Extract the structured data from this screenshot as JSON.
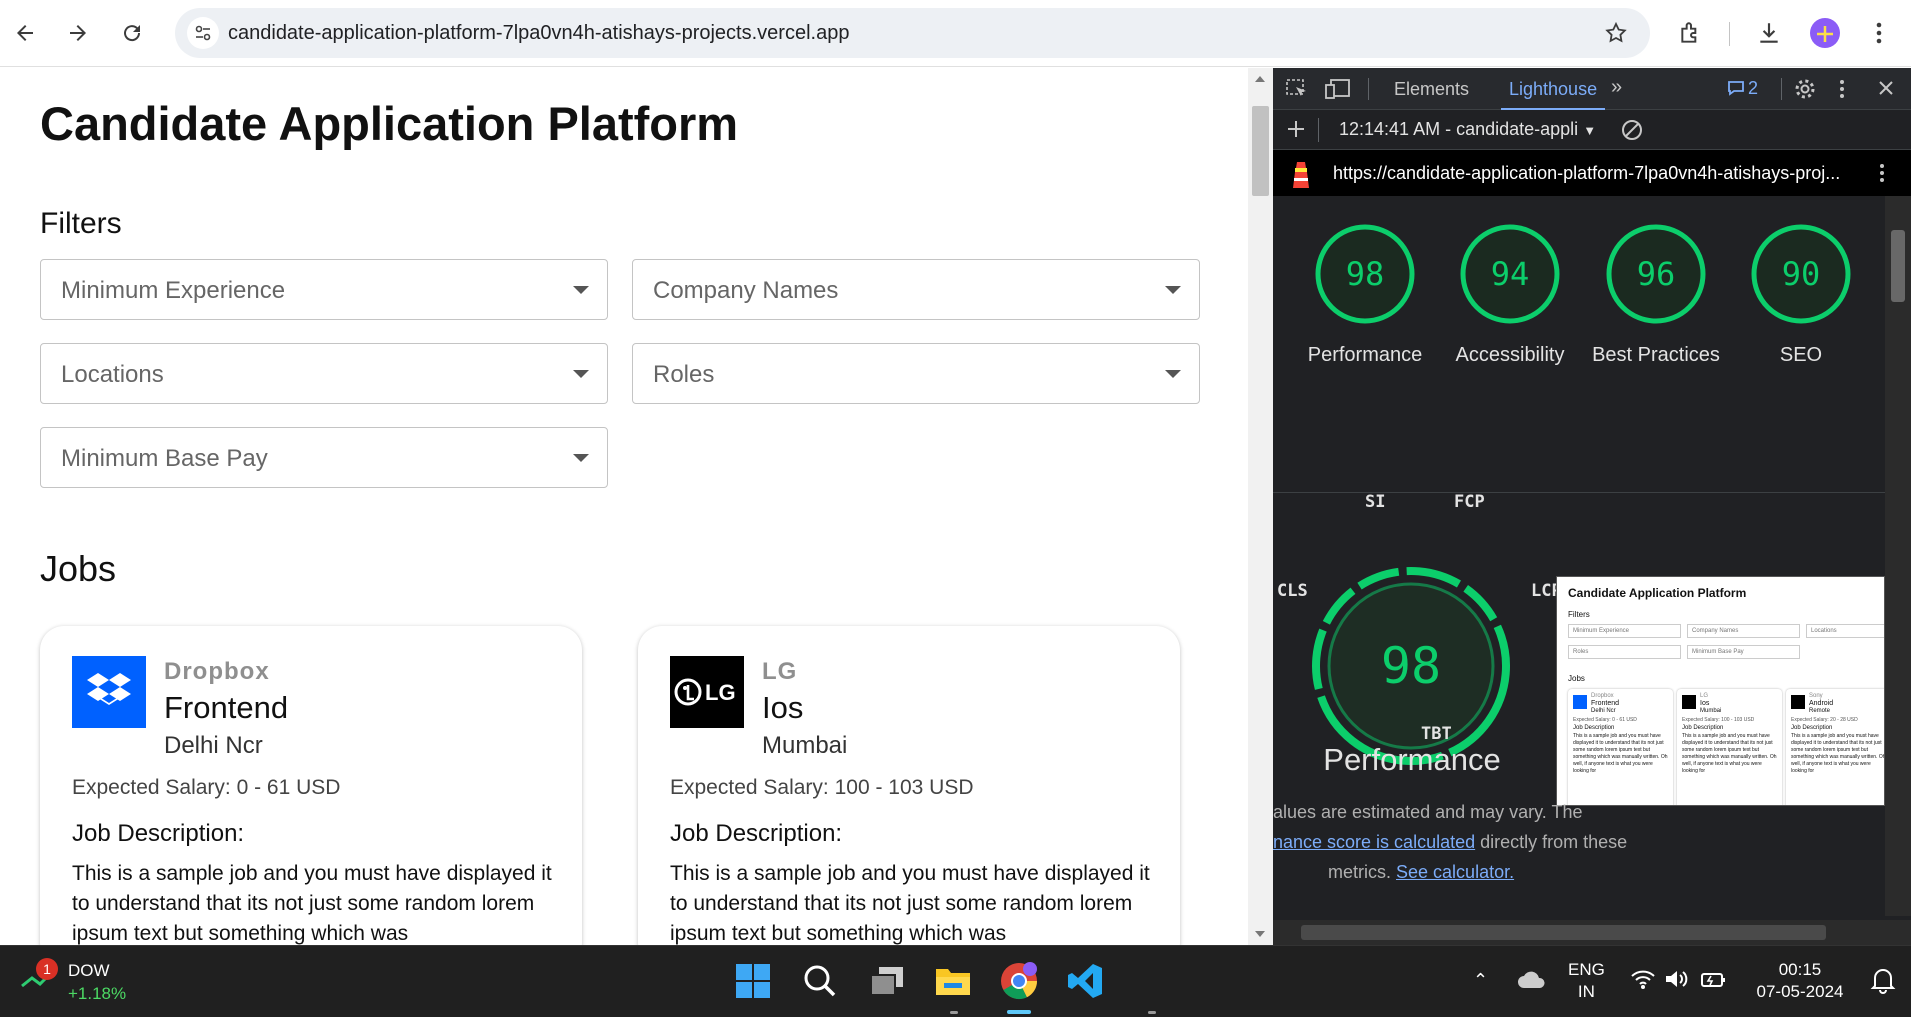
{
  "browser": {
    "url": "candidate-application-platform-7lpa0vn4h-atishays-projects.vercel.app"
  },
  "page": {
    "title": "Candidate Application Platform",
    "filters_heading": "Filters",
    "filters": [
      "Minimum Experience",
      "Company Names",
      "Locations",
      "Roles",
      "Minimum Base Pay"
    ],
    "jobs_heading": "Jobs",
    "jobs": [
      {
        "company": "Dropbox",
        "role": "Frontend",
        "location": "Delhi Ncr",
        "salary": "Expected Salary: 0 - 61 USD",
        "jd_title": "Job Description:",
        "jd": "This is a sample job and you must have displayed it to understand that its not just some random lorem ipsum text but something which was"
      },
      {
        "company": "LG",
        "role": "Ios",
        "location": "Mumbai",
        "salary": "Expected Salary: 100 - 103 USD",
        "jd_title": "Job Description:",
        "jd": "This is a sample job and you must have displayed it to understand that its not just some random lorem ipsum text but something which was"
      }
    ]
  },
  "devtools": {
    "tabs": [
      "Elements",
      "Lighthouse"
    ],
    "issues_count": "2",
    "report_select": "12:14:41 AM - candidate-appli",
    "report_url": "https://candidate-application-platform-7lpa0vn4h-atishays-proj...",
    "scores": [
      {
        "label": "Performance",
        "value": 98
      },
      {
        "label": "Accessibility",
        "value": 94
      },
      {
        "label": "Best Practices",
        "value": 96
      },
      {
        "label": "SEO",
        "value": 90
      }
    ],
    "perf_score": "98",
    "perf_title": "Performance",
    "metrics": [
      "SI",
      "FCP",
      "CLS",
      "LCP",
      "TBT"
    ],
    "note_line1": "alues are estimated and may vary. The",
    "note_link1": "nance score is calculated",
    "note_line2": " directly from these",
    "note_line3": "metrics.",
    "note_link2": "See calculator.",
    "thumb": {
      "title": "Candidate Application Platform",
      "filters": "Filters",
      "f1": "Minimum Experience",
      "f2": "Company Names",
      "f3": "Locations",
      "f4": "Roles",
      "f5": "Minimum Base Pay",
      "jobs": "Jobs",
      "c1": "Dropbox",
      "r1": "Frontend",
      "l1": "Delhi Ncr",
      "c2": "LG",
      "r2": "Ios",
      "l2": "Mumbai",
      "c3": "Sony",
      "r3": "Android",
      "l3": "Remote",
      "s1": "Expected Salary: 0 - 61 USD",
      "s2": "Expected Salary: 100 - 103 USD",
      "s3": "Expected Salary: 20 - 28 USD",
      "jd": "Job Description",
      "jdtext": "This is a sample job and you must have displayed it to understand that its not just some random lorem ipsum text but something which was manually written. Oh well, if anyone text is what you were looking for"
    }
  },
  "taskbar": {
    "stock_name": "DOW",
    "stock_change": "+1.18%",
    "stock_badge": "1",
    "lang1": "ENG",
    "lang2": "IN",
    "time": "00:15",
    "date": "07-05-2024"
  },
  "colors": {
    "score_green": "#0cce6b",
    "link_blue": "#7cacf8",
    "dropbox_blue": "#0061ff"
  }
}
